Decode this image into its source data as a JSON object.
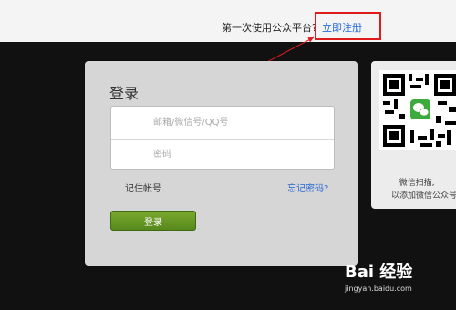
{
  "topbar": {
    "prompt": "第一次使用公众平台?",
    "register_link": "立即注册"
  },
  "login": {
    "title": "登录",
    "account_placeholder": "邮箱/微信号/QQ号",
    "password_placeholder": "密码",
    "remember_label": "记住帐号",
    "forgot_label": "忘记密码?",
    "submit_label": "登录"
  },
  "qr": {
    "line1": "微信扫描,",
    "line2": "以添加微信公众号"
  },
  "watermark": {
    "logo": "Bai 经验",
    "site": "jingyan.baidu.com"
  },
  "colors": {
    "link": "#2a6bd6",
    "button": "#5f8f1f",
    "annotation": "#e01b1b"
  }
}
